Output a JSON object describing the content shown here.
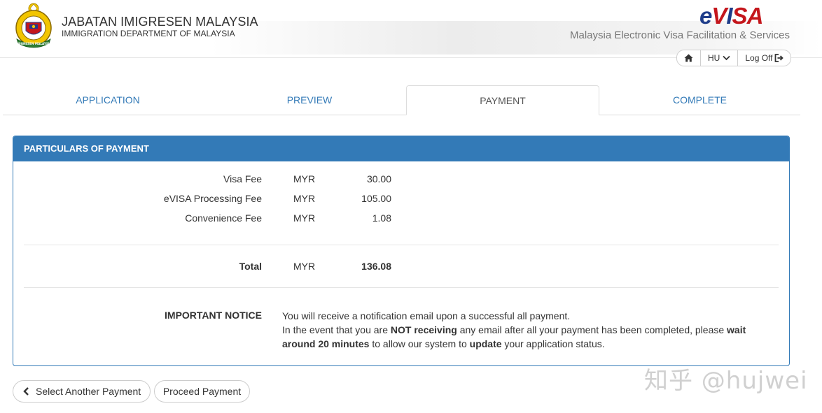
{
  "header": {
    "agency_title": "JABATAN IMIGRESEN MALAYSIA",
    "agency_subtitle": "IMMIGRATION DEPARTMENT OF MALAYSIA",
    "crest_text": "IMIGRESEN MALAYSIA",
    "logo": {
      "e": "e",
      "v": "V",
      "i": "I",
      "s": "S",
      "a": "A"
    },
    "tagline": "Malaysia Electronic Visa Facilitation & Services",
    "language": "HU",
    "logoff_label": "Log Off"
  },
  "tabs": [
    {
      "label": "APPLICATION",
      "active": false
    },
    {
      "label": "PREVIEW",
      "active": false
    },
    {
      "label": "PAYMENT",
      "active": true
    },
    {
      "label": "COMPLETE",
      "active": false
    }
  ],
  "panel": {
    "heading": "PARTICULARS OF PAYMENT",
    "fees": [
      {
        "label": "Visa Fee",
        "currency": "MYR",
        "amount": "30.00"
      },
      {
        "label": "eVISA Processing Fee",
        "currency": "MYR",
        "amount": "105.00"
      },
      {
        "label": "Convenience Fee",
        "currency": "MYR",
        "amount": "1.08"
      }
    ],
    "total": {
      "label": "Total",
      "currency": "MYR",
      "amount": "136.08"
    },
    "notice": {
      "label": "IMPORTANT NOTICE",
      "line1": "You will receive a notification email upon a successful all payment.",
      "line2_a": "In the event that you are ",
      "line2_b": "NOT receiving",
      "line2_c": " any email after all your payment has been completed, please ",
      "line2_d": "wait around 20 minutes",
      "line2_e": " to allow our system to ",
      "line2_f": "update",
      "line2_g": " your application status."
    }
  },
  "buttons": {
    "select_another": "Select Another Payment",
    "proceed": "Proceed Payment"
  },
  "watermark": "知乎 @hujwei",
  "colors": {
    "primary": "#337ab7",
    "logo_blue": "#1f3d8a",
    "logo_red": "#c4161c"
  }
}
